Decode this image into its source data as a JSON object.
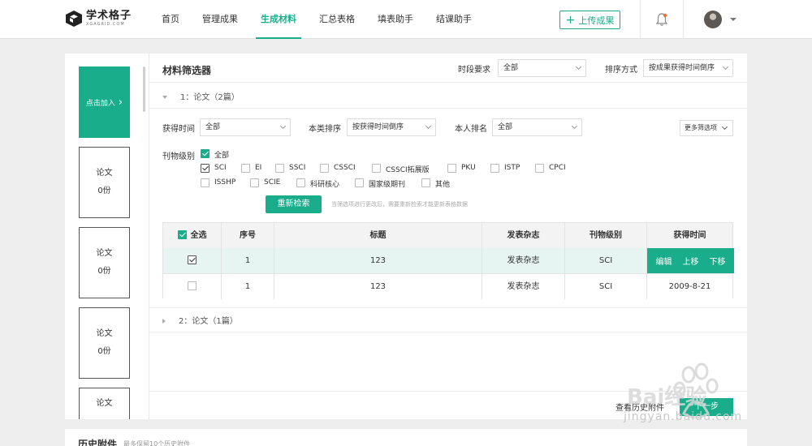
{
  "header": {
    "logo_name": "学术格子",
    "logo_sub": "XGAGRID.COM",
    "nav": [
      "首页",
      "管理成果",
      "生成材料",
      "汇总表格",
      "填表助手",
      "结课助手"
    ],
    "active_nav": "生成材料",
    "upload_label": "上传成果",
    "accent_color": "#1aad8c"
  },
  "sidebar": {
    "add_label": "点击加入",
    "cards": [
      {
        "title": "论文",
        "count": "0份"
      },
      {
        "title": "论文",
        "count": "0份"
      },
      {
        "title": "论文",
        "count": "0份"
      },
      {
        "title": "论文",
        "count": ""
      }
    ]
  },
  "filter": {
    "title": "材料筛选器",
    "period_label": "时段要求",
    "period_value": "全部",
    "sort_label": "排序方式",
    "sort_value": "按成果获得时间倒序",
    "group1": "1：论文（2篇）",
    "group2": "2：论文（1篇）",
    "obtain_label": "获得时间",
    "obtain_value": "全部",
    "type_sort_label": "本类排序",
    "type_sort_value": "按获得时间倒序",
    "rank_label": "本人排名",
    "rank_value": "全部",
    "more_label": "更多筛选项",
    "level_label": "刊物级别",
    "level_all": "全部",
    "levels_row1": [
      "SCI",
      "EI",
      "SSCI",
      "CSSCI",
      "CSSCI拓展版",
      "PKU",
      "ISTP",
      "CPCI"
    ],
    "levels_row2": [
      "ISSHP",
      "SCIE",
      "科研核心",
      "国家级期刊",
      "其他"
    ],
    "search_label": "重新检索",
    "hint": "当筛选项进行更改后，需要重新检索才能更新表格数据"
  },
  "table": {
    "headers": [
      "全选",
      "序号",
      "标题",
      "发表杂志",
      "刊物级别",
      "获得时间"
    ],
    "rows": [
      {
        "index": "1",
        "title": "123",
        "journal": "发表杂志",
        "level": "SCI",
        "time": "",
        "checked": true
      },
      {
        "index": "1",
        "title": "123",
        "journal": "发表杂志",
        "level": "SCI",
        "time": "2009-8-21",
        "checked": false
      }
    ],
    "ops": [
      "编辑",
      "上移",
      "下移"
    ]
  },
  "footer": {
    "history_link": "查看历史附件",
    "next_label": "下一步",
    "history_title": "历史附件",
    "history_note": "最多保留10个历史附件"
  },
  "watermark": {
    "text": "jingyan.baidu.com",
    "brand": "Bai经验"
  }
}
